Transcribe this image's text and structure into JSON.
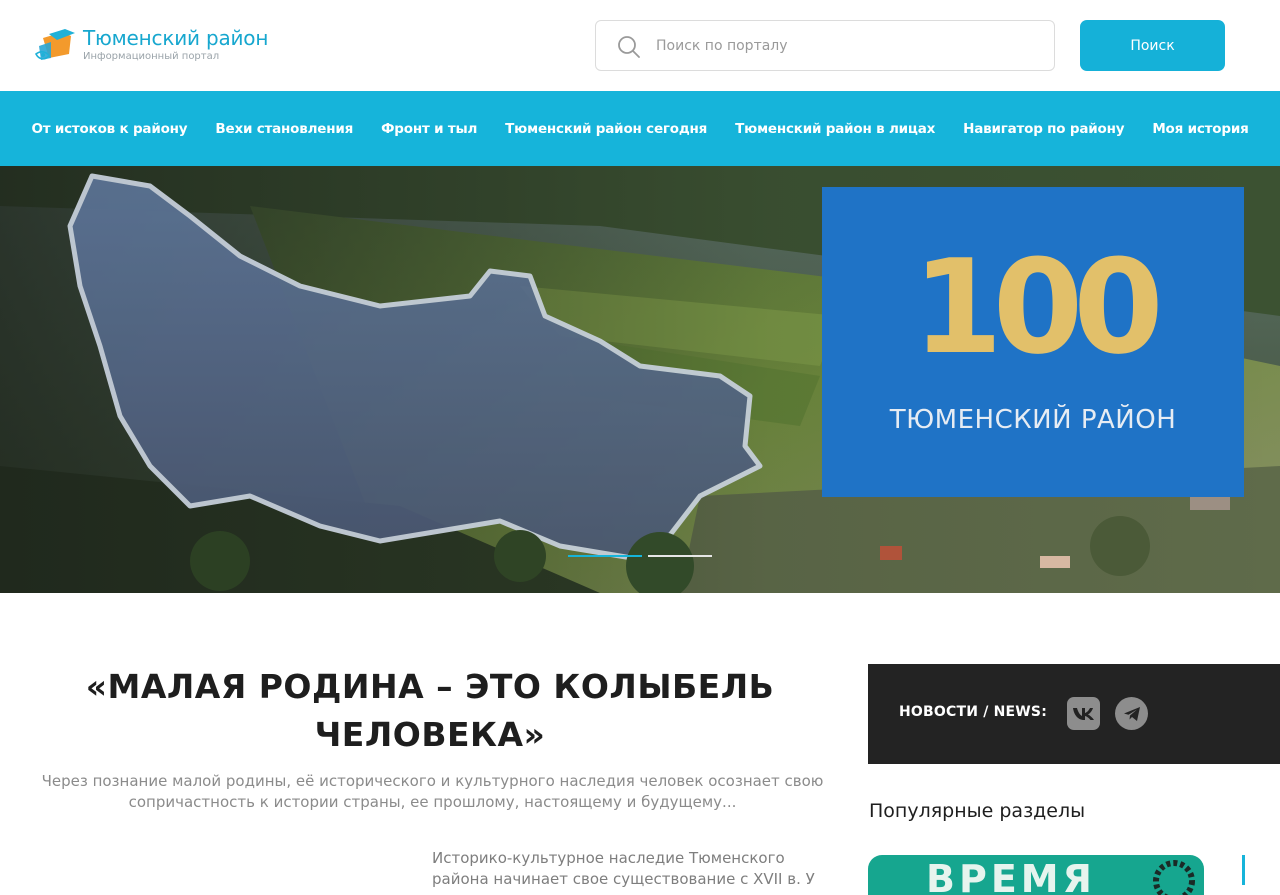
{
  "header": {
    "logo_title": "Тюменский район",
    "logo_subtitle": "Информационный портал",
    "search_placeholder": "Поиск по порталу",
    "search_button": "Поиск"
  },
  "nav": {
    "items": [
      "От истоков к району",
      "Вехи становления",
      "Фронт и тыл",
      "Тюменский район сегодня",
      "Тюменский район в лицах",
      "Навигатор по району",
      "Моя история"
    ]
  },
  "hero": {
    "badge_number": "100",
    "badge_text": "ТЮМЕНСКИЙ РАЙОН",
    "slides_total": 2,
    "slide_active": 1
  },
  "main": {
    "quote_line1": "«МАЛАЯ РОДИНА – ЭТО КОЛЫБЕЛЬ",
    "quote_line2": "ЧЕЛОВЕКА»",
    "intro": "Через познание малой родины, её исторического и культурного наследия человек осознает свою сопричастность к истории страны, ее прошлому, настоящему и будущему...",
    "history_line1": "Историко-культурное наследие Тюменского",
    "history_line2": "района начинает свое существование с XVII в. У"
  },
  "sidebar": {
    "news_label": "НОВОСТИ / NEWS:",
    "social_icons": [
      "vk-icon",
      "telegram-icon"
    ],
    "popular_title": "Популярные разделы",
    "popular_card_text": "ВРЕМЯ"
  },
  "colors": {
    "accent": "#16b4da",
    "badge_blue": "#1f73c6",
    "badge_gold": "#e2c06a",
    "dark_box": "#232323"
  }
}
